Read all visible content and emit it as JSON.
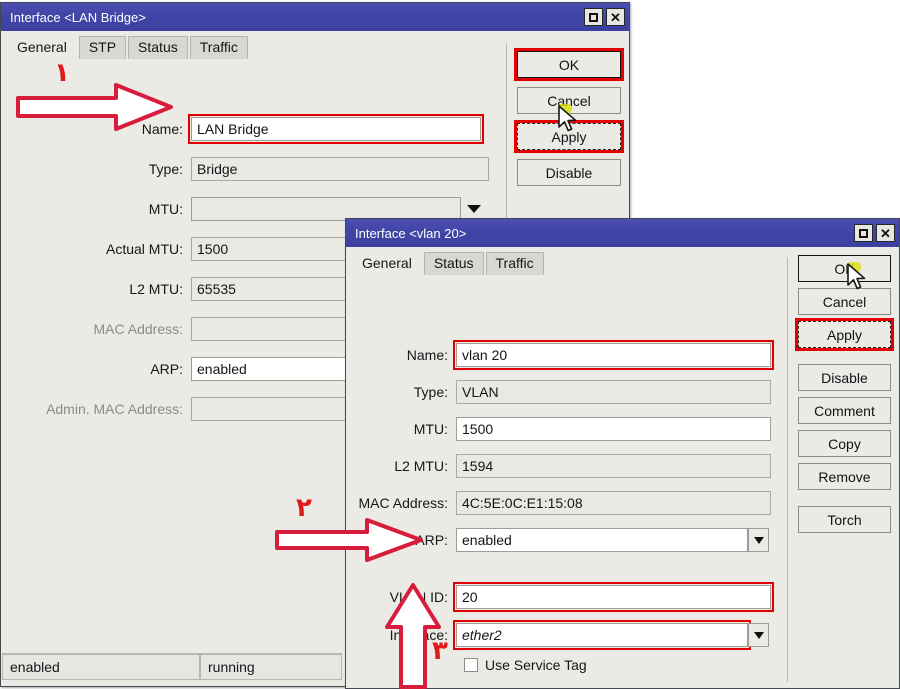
{
  "windows": [
    {
      "id": "bridge",
      "title": "Interface <LAN Bridge>",
      "titlebar_buttons": [
        {
          "name": "maximize-icon",
          "glyph": "maximize"
        },
        {
          "name": "close-icon",
          "glyph": "close"
        }
      ],
      "tabs": [
        {
          "label": "General",
          "active": true
        },
        {
          "label": "STP",
          "active": false
        },
        {
          "label": "Status",
          "active": false
        },
        {
          "label": "Traffic",
          "active": false
        }
      ],
      "fields": [
        {
          "label": "Name:",
          "value": "LAN Bridge",
          "readonly": false,
          "highlight": true,
          "dropdown": false
        },
        {
          "label": "Type:",
          "value": "Bridge",
          "readonly": true,
          "highlight": false,
          "dropdown": false
        },
        {
          "label": "MTU:",
          "value": "",
          "readonly": true,
          "highlight": false,
          "dropdown": true
        },
        {
          "label": "Actual MTU:",
          "value": "1500",
          "readonly": true,
          "highlight": false,
          "dropdown": false
        },
        {
          "label": "L2 MTU:",
          "value": "65535",
          "readonly": true,
          "highlight": false,
          "dropdown": false
        },
        {
          "label": "MAC Address:",
          "value": "",
          "readonly": true,
          "highlight": false,
          "dropdown": false
        },
        {
          "label": "ARP:",
          "value": "enabled",
          "readonly": false,
          "highlight": false,
          "dropdown": false
        },
        {
          "label": "Admin. MAC Address:",
          "value": "",
          "readonly": true,
          "highlight": false,
          "dropdown": false
        }
      ],
      "buttons": [
        {
          "label": "OK",
          "highlight": true,
          "focus": false
        },
        {
          "label": "Cancel",
          "highlight": false,
          "focus": false
        },
        {
          "label": "Apply",
          "highlight": true,
          "focus": true
        },
        {
          "label": "Disable",
          "highlight": false,
          "focus": false
        }
      ],
      "statusbar": [
        "enabled",
        "running"
      ]
    },
    {
      "id": "vlan",
      "title": "Interface <vlan 20>",
      "titlebar_buttons": [
        {
          "name": "maximize-icon",
          "glyph": "maximize"
        },
        {
          "name": "close-icon",
          "glyph": "close"
        }
      ],
      "tabs": [
        {
          "label": "General",
          "active": true
        },
        {
          "label": "Status",
          "active": false
        },
        {
          "label": "Traffic",
          "active": false
        }
      ],
      "fields": [
        {
          "label": "Name:",
          "value": "vlan 20",
          "readonly": false,
          "highlight": true,
          "dropdown": false,
          "italic": false
        },
        {
          "label": "Type:",
          "value": "VLAN",
          "readonly": true,
          "highlight": false,
          "dropdown": false,
          "italic": false
        },
        {
          "label": "MTU:",
          "value": "1500",
          "readonly": false,
          "highlight": false,
          "dropdown": false,
          "italic": false
        },
        {
          "label": "L2 MTU:",
          "value": "1594",
          "readonly": true,
          "highlight": false,
          "dropdown": false,
          "italic": false
        },
        {
          "label": "MAC Address:",
          "value": "4C:5E:0C:E1:15:08",
          "readonly": true,
          "highlight": false,
          "dropdown": false,
          "italic": false
        },
        {
          "label": "ARP:",
          "value": "enabled",
          "readonly": false,
          "highlight": false,
          "dropdown": true,
          "italic": false
        },
        {
          "label": "VLAN ID:",
          "value": "20",
          "readonly": false,
          "highlight": true,
          "dropdown": false,
          "italic": false
        },
        {
          "label": "Interface:",
          "value": "ether2",
          "readonly": false,
          "highlight": true,
          "dropdown": true,
          "italic": true
        }
      ],
      "checkbox": {
        "label": "Use Service Tag",
        "checked": false
      },
      "buttons": [
        {
          "label": "OK",
          "highlight": false,
          "focus": false,
          "black": true
        },
        {
          "label": "Cancel",
          "highlight": false,
          "focus": false,
          "black": false
        },
        {
          "label": "Apply",
          "highlight": true,
          "focus": true,
          "black": false
        },
        {
          "label": "Disable",
          "highlight": false,
          "focus": false,
          "black": false
        },
        {
          "label": "Comment",
          "highlight": false,
          "focus": false,
          "black": false
        },
        {
          "label": "Copy",
          "highlight": false,
          "focus": false,
          "black": false
        },
        {
          "label": "Remove",
          "highlight": false,
          "focus": false,
          "black": false
        },
        {
          "label": "Torch",
          "highlight": false,
          "focus": false,
          "black": false
        }
      ]
    }
  ],
  "annotations": [
    {
      "number": "۱",
      "target": "Name",
      "direction": "right"
    },
    {
      "number": "۲",
      "target": "VLAN ID",
      "direction": "right"
    },
    {
      "number": "۳",
      "target": "Interface",
      "direction": "up"
    }
  ],
  "colors": {
    "titlebar": "#4145a8",
    "annotation_red": "#e01a1a",
    "highlight_red": "#e40000",
    "window_face": "#eceae4"
  }
}
